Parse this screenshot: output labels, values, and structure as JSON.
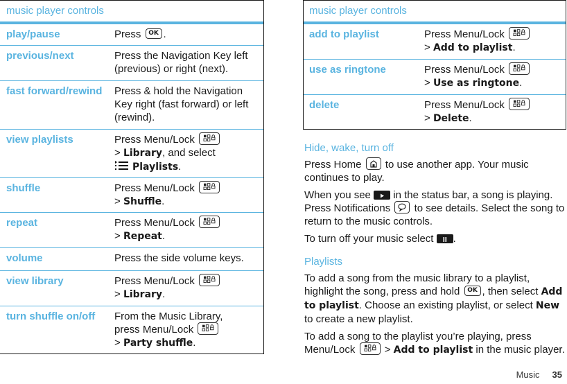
{
  "left_table": {
    "title": "music player controls",
    "rows": [
      {
        "key": "play/pause",
        "v": {
          "pre": "Press",
          "post": "."
        }
      },
      {
        "key": "previous/next",
        "v": {
          "text": "Press the Navigation Key left (previous) or right (next)."
        }
      },
      {
        "key": "fast forward/rewind",
        "v": {
          "text": "Press & hold the Navigation Key right (fast forward) or left (rewind)."
        }
      },
      {
        "key": "view playlists",
        "v": {
          "pre": "Press Menu/Lock",
          "arrow": ">",
          "bold": "Library",
          "mid": ", and select",
          "bold2": "Playlists",
          "post": "."
        }
      },
      {
        "key": "shuffle",
        "v": {
          "pre": "Press Menu/Lock",
          "arrow": ">",
          "bold": "Shuffle",
          "post": "."
        }
      },
      {
        "key": "repeat",
        "v": {
          "pre": "Press Menu/Lock",
          "arrow": ">",
          "bold": "Repeat",
          "post": "."
        }
      },
      {
        "key": "volume",
        "v": {
          "text": "Press the side volume keys."
        }
      },
      {
        "key": "view library",
        "v": {
          "pre": "Press Menu/Lock",
          "arrow": ">",
          "bold": "Library",
          "post": "."
        }
      },
      {
        "key": "turn shuffle on/off",
        "v": {
          "pre0": "From the Music Library,",
          "pre": "press Menu/Lock",
          "arrow": ">",
          "bold": "Party shuffle",
          "post": "."
        }
      }
    ]
  },
  "right_table": {
    "title": "music player controls",
    "rows": [
      {
        "key": "add to playlist",
        "v": {
          "pre": "Press Menu/Lock",
          "arrow": ">",
          "bold": "Add to playlist",
          "post": "."
        }
      },
      {
        "key": "use as ringtone",
        "v": {
          "pre": "Press Menu/Lock",
          "arrow": ">",
          "bold": "Use as ringtone",
          "post": "."
        }
      },
      {
        "key": "delete",
        "v": {
          "pre": "Press Menu/Lock",
          "arrow": ">",
          "bold": "Delete",
          "post": "."
        }
      }
    ]
  },
  "hide_section": {
    "heading": "Hide, wake, turn off",
    "p1": {
      "a": "Press Home",
      "b": "to use another app. Your music continues to play."
    },
    "p2": {
      "a": "When you see",
      "b": "in the status bar, a song is playing. Press Notifications",
      "c": "to see details. Select the song to return to the music controls."
    },
    "p3": {
      "a": "To turn off your music select",
      "b": "."
    }
  },
  "playlists_section": {
    "heading": "Playlists",
    "p1": {
      "a": "To add a song from the music library to a playlist, highlight the song, press and hold",
      "b": ", then select",
      "bold1": "Add to playlist",
      "c": ". Choose an existing playlist, or select",
      "bold2": "New",
      "d": "to create a new playlist."
    },
    "p2": {
      "a": "To add a song to the playlist you’re playing, press Menu/Lock",
      "arrow": ">",
      "bold": "Add to playlist",
      "b": "in the music player."
    }
  },
  "keys": {
    "ok": "OK"
  },
  "footer": {
    "section": "Music",
    "page": "35"
  },
  "colors": {
    "accent": "#5ab4e0",
    "text": "#1a1a1a"
  }
}
